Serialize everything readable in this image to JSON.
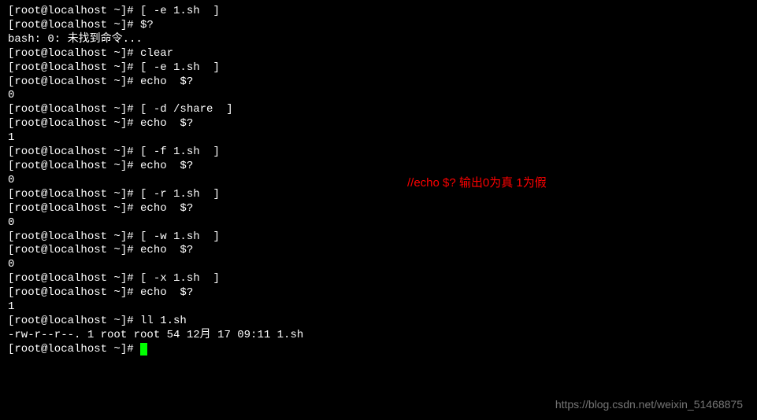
{
  "prompt": {
    "user": "root",
    "host": "localhost",
    "path": "~",
    "symbol": "#"
  },
  "lines": [
    {
      "type": "prompt",
      "cmd": "[ -e 1.sh  ]"
    },
    {
      "type": "prompt",
      "cmd": "$?"
    },
    {
      "type": "output",
      "text": "bash: 0: 未找到命令..."
    },
    {
      "type": "prompt",
      "cmd": "clear"
    },
    {
      "type": "prompt",
      "cmd": "[ -e 1.sh  ]"
    },
    {
      "type": "prompt",
      "cmd": "echo  $?"
    },
    {
      "type": "output",
      "text": "0"
    },
    {
      "type": "prompt",
      "cmd": "[ -d /share  ]"
    },
    {
      "type": "prompt",
      "cmd": "echo  $?"
    },
    {
      "type": "output",
      "text": "1"
    },
    {
      "type": "prompt",
      "cmd": "[ -f 1.sh  ]"
    },
    {
      "type": "prompt",
      "cmd": "echo  $?"
    },
    {
      "type": "output",
      "text": "0"
    },
    {
      "type": "prompt",
      "cmd": "[ -r 1.sh  ]"
    },
    {
      "type": "prompt",
      "cmd": "echo  $?"
    },
    {
      "type": "output",
      "text": "0"
    },
    {
      "type": "prompt",
      "cmd": "[ -w 1.sh  ]"
    },
    {
      "type": "prompt",
      "cmd": "echo  $?"
    },
    {
      "type": "output",
      "text": "0"
    },
    {
      "type": "prompt",
      "cmd": "[ -x 1.sh  ]"
    },
    {
      "type": "prompt",
      "cmd": "echo  $?"
    },
    {
      "type": "output",
      "text": "1"
    },
    {
      "type": "prompt",
      "cmd": "ll 1.sh"
    },
    {
      "type": "output",
      "text": "-rw-r--r--. 1 root root 54 12月 17 09:11 1.sh"
    },
    {
      "type": "prompt-cursor",
      "cmd": ""
    }
  ],
  "annotation": "//echo $? 输出0为真  1为假",
  "watermark": "https://blog.csdn.net/weixin_51468875"
}
